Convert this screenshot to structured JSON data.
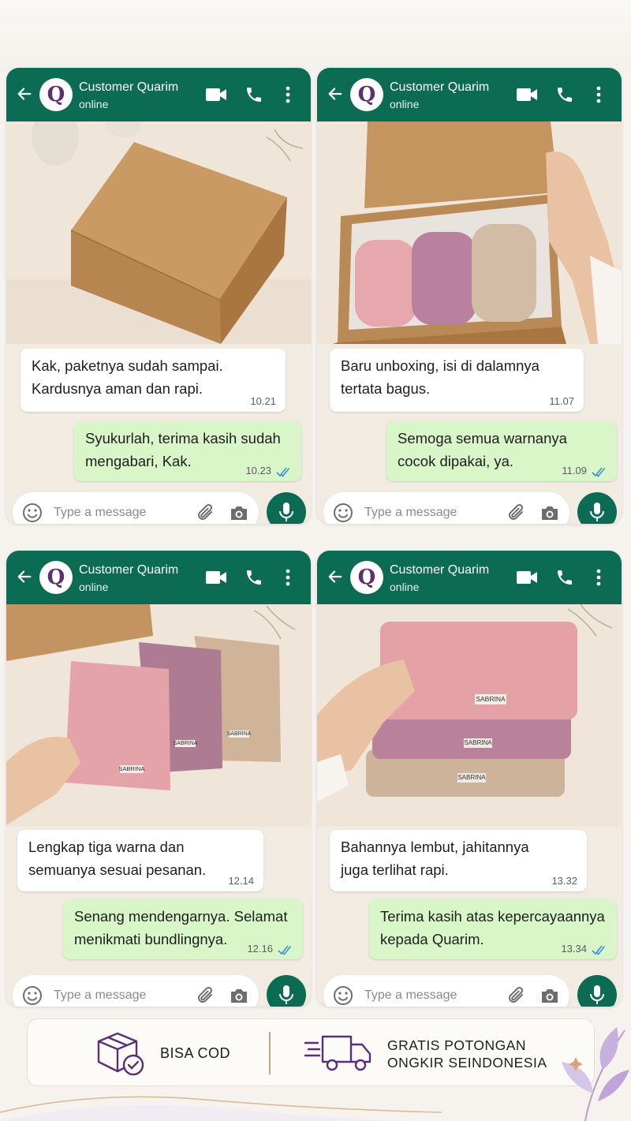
{
  "contact": {
    "name": "Customer Quarim",
    "status": "online",
    "avatar_letter": "Q"
  },
  "input": {
    "placeholder": "Type a message"
  },
  "panels": [
    {
      "photo": "closed kraft cardboard box on linen",
      "incoming": {
        "line1": "Kak, paketnya sudah sampai.",
        "line2": "Kardusnya aman dan rapi.",
        "time": "10.21"
      },
      "outgoing": {
        "line1": "Syukurlah, terima kasih sudah",
        "line2": "mengabari, Kak.",
        "time": "10.23"
      }
    },
    {
      "photo": "opened box with three rolled fabrics",
      "incoming": {
        "line1": "Baru unboxing, isi di dalamnya",
        "line2": "tertata bagus.",
        "time": "11.07"
      },
      "outgoing": {
        "line1": "Semoga semua warnanya",
        "line2": "cocok dipakai, ya.",
        "time": "11.09"
      }
    },
    {
      "photo": "three folded fabrics fanned out",
      "incoming": {
        "line1": "Lengkap tiga warna dan",
        "line2": "semuanya sesuai pesanan.",
        "time": "12.14"
      },
      "outgoing": {
        "line1": "Senang mendengarnya. Selamat",
        "line2": "menikmati bundlingnya.",
        "time": "12.16"
      }
    },
    {
      "photo": "hand holding stack of folded fabrics",
      "incoming": {
        "line1": "Bahannya lembut, jahitannya",
        "line2": "juga terlihat rapi.",
        "time": "13.32"
      },
      "outgoing": {
        "line1": "Terima kasih atas kepercayaannya",
        "line2": "kepada Quarim.",
        "time": "13.34"
      }
    }
  ],
  "product_label": "SABRINA",
  "footer": {
    "cod": "BISA COD",
    "shipping_line1": "GRATIS POTONGAN",
    "shipping_line2": "ONGKIR SEINDONESIA"
  },
  "colors": {
    "header_green": "#0c6b53",
    "outgoing_bubble": "#d9f6c9",
    "incoming_bubble": "#ffffff",
    "read_tick": "#3b8fd9",
    "brand_purple": "#5a2f73"
  },
  "icons": [
    "back-arrow-icon",
    "video-call-icon",
    "phone-icon",
    "more-vert-icon",
    "emoji-icon",
    "attach-icon",
    "camera-icon",
    "mic-icon",
    "box-check-icon",
    "delivery-truck-icon"
  ]
}
